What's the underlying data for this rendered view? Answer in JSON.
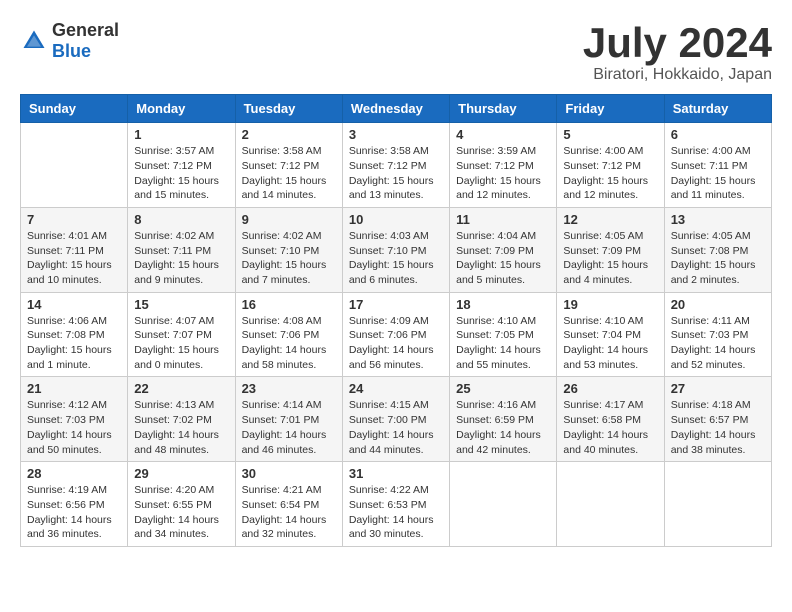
{
  "header": {
    "logo_general": "General",
    "logo_blue": "Blue",
    "title": "July 2024",
    "subtitle": "Biratori, Hokkaido, Japan"
  },
  "weekdays": [
    "Sunday",
    "Monday",
    "Tuesday",
    "Wednesday",
    "Thursday",
    "Friday",
    "Saturday"
  ],
  "weeks": [
    [
      {
        "day": "",
        "info": ""
      },
      {
        "day": "1",
        "info": "Sunrise: 3:57 AM\nSunset: 7:12 PM\nDaylight: 15 hours\nand 15 minutes."
      },
      {
        "day": "2",
        "info": "Sunrise: 3:58 AM\nSunset: 7:12 PM\nDaylight: 15 hours\nand 14 minutes."
      },
      {
        "day": "3",
        "info": "Sunrise: 3:58 AM\nSunset: 7:12 PM\nDaylight: 15 hours\nand 13 minutes."
      },
      {
        "day": "4",
        "info": "Sunrise: 3:59 AM\nSunset: 7:12 PM\nDaylight: 15 hours\nand 12 minutes."
      },
      {
        "day": "5",
        "info": "Sunrise: 4:00 AM\nSunset: 7:12 PM\nDaylight: 15 hours\nand 12 minutes."
      },
      {
        "day": "6",
        "info": "Sunrise: 4:00 AM\nSunset: 7:11 PM\nDaylight: 15 hours\nand 11 minutes."
      }
    ],
    [
      {
        "day": "7",
        "info": "Sunrise: 4:01 AM\nSunset: 7:11 PM\nDaylight: 15 hours\nand 10 minutes."
      },
      {
        "day": "8",
        "info": "Sunrise: 4:02 AM\nSunset: 7:11 PM\nDaylight: 15 hours\nand 9 minutes."
      },
      {
        "day": "9",
        "info": "Sunrise: 4:02 AM\nSunset: 7:10 PM\nDaylight: 15 hours\nand 7 minutes."
      },
      {
        "day": "10",
        "info": "Sunrise: 4:03 AM\nSunset: 7:10 PM\nDaylight: 15 hours\nand 6 minutes."
      },
      {
        "day": "11",
        "info": "Sunrise: 4:04 AM\nSunset: 7:09 PM\nDaylight: 15 hours\nand 5 minutes."
      },
      {
        "day": "12",
        "info": "Sunrise: 4:05 AM\nSunset: 7:09 PM\nDaylight: 15 hours\nand 4 minutes."
      },
      {
        "day": "13",
        "info": "Sunrise: 4:05 AM\nSunset: 7:08 PM\nDaylight: 15 hours\nand 2 minutes."
      }
    ],
    [
      {
        "day": "14",
        "info": "Sunrise: 4:06 AM\nSunset: 7:08 PM\nDaylight: 15 hours\nand 1 minute."
      },
      {
        "day": "15",
        "info": "Sunrise: 4:07 AM\nSunset: 7:07 PM\nDaylight: 15 hours\nand 0 minutes."
      },
      {
        "day": "16",
        "info": "Sunrise: 4:08 AM\nSunset: 7:06 PM\nDaylight: 14 hours\nand 58 minutes."
      },
      {
        "day": "17",
        "info": "Sunrise: 4:09 AM\nSunset: 7:06 PM\nDaylight: 14 hours\nand 56 minutes."
      },
      {
        "day": "18",
        "info": "Sunrise: 4:10 AM\nSunset: 7:05 PM\nDaylight: 14 hours\nand 55 minutes."
      },
      {
        "day": "19",
        "info": "Sunrise: 4:10 AM\nSunset: 7:04 PM\nDaylight: 14 hours\nand 53 minutes."
      },
      {
        "day": "20",
        "info": "Sunrise: 4:11 AM\nSunset: 7:03 PM\nDaylight: 14 hours\nand 52 minutes."
      }
    ],
    [
      {
        "day": "21",
        "info": "Sunrise: 4:12 AM\nSunset: 7:03 PM\nDaylight: 14 hours\nand 50 minutes."
      },
      {
        "day": "22",
        "info": "Sunrise: 4:13 AM\nSunset: 7:02 PM\nDaylight: 14 hours\nand 48 minutes."
      },
      {
        "day": "23",
        "info": "Sunrise: 4:14 AM\nSunset: 7:01 PM\nDaylight: 14 hours\nand 46 minutes."
      },
      {
        "day": "24",
        "info": "Sunrise: 4:15 AM\nSunset: 7:00 PM\nDaylight: 14 hours\nand 44 minutes."
      },
      {
        "day": "25",
        "info": "Sunrise: 4:16 AM\nSunset: 6:59 PM\nDaylight: 14 hours\nand 42 minutes."
      },
      {
        "day": "26",
        "info": "Sunrise: 4:17 AM\nSunset: 6:58 PM\nDaylight: 14 hours\nand 40 minutes."
      },
      {
        "day": "27",
        "info": "Sunrise: 4:18 AM\nSunset: 6:57 PM\nDaylight: 14 hours\nand 38 minutes."
      }
    ],
    [
      {
        "day": "28",
        "info": "Sunrise: 4:19 AM\nSunset: 6:56 PM\nDaylight: 14 hours\nand 36 minutes."
      },
      {
        "day": "29",
        "info": "Sunrise: 4:20 AM\nSunset: 6:55 PM\nDaylight: 14 hours\nand 34 minutes."
      },
      {
        "day": "30",
        "info": "Sunrise: 4:21 AM\nSunset: 6:54 PM\nDaylight: 14 hours\nand 32 minutes."
      },
      {
        "day": "31",
        "info": "Sunrise: 4:22 AM\nSunset: 6:53 PM\nDaylight: 14 hours\nand 30 minutes."
      },
      {
        "day": "",
        "info": ""
      },
      {
        "day": "",
        "info": ""
      },
      {
        "day": "",
        "info": ""
      }
    ]
  ]
}
